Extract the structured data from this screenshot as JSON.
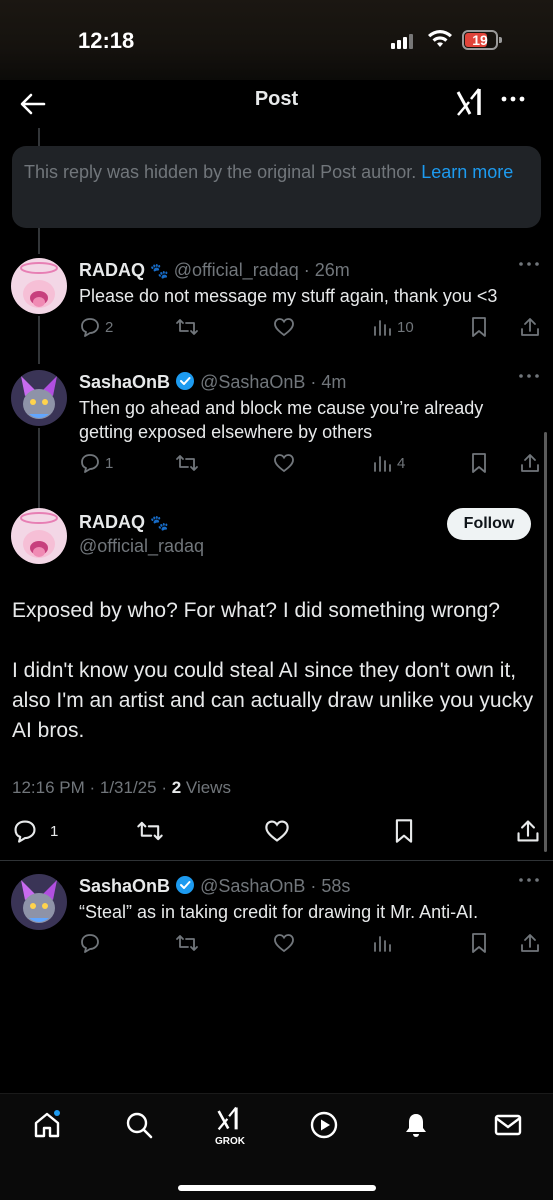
{
  "status_bar": {
    "time": "12:18",
    "battery": "19"
  },
  "nav": {
    "title": "Post"
  },
  "hidden_notice": {
    "text": "This reply was hidden by the original Post author.",
    "link": "Learn more"
  },
  "replies": [
    {
      "name": "RADAQ",
      "handle": "@official_radaq",
      "time": "26m",
      "text": "Please do not message my stuff again, thank you <3",
      "reply_count": "2",
      "views": "10"
    },
    {
      "name": "SashaOnB",
      "handle": "@SashaOnB",
      "time": "4m",
      "text": "Then go ahead and block me cause you’re already getting exposed elsewhere by others",
      "reply_count": "1",
      "views": "4"
    }
  ],
  "main_post": {
    "name": "RADAQ",
    "handle": "@official_radaq",
    "follow_label": "Follow",
    "paragraph1": "Exposed by who? For what? I did something wrong?",
    "paragraph2": "I didn't know you could steal AI since they don't own it, also I'm an artist and can actually draw unlike you yucky AI bros.",
    "timestamp": "12:16 PM · 1/31/25 · ",
    "views_count": "2",
    "views_label": "Views",
    "reply_count": "1"
  },
  "last_reply": {
    "name": "SashaOnB",
    "handle": "@SashaOnB",
    "time": "58s",
    "text": "“Steal” as in taking credit for drawing it Mr. Anti-AI."
  },
  "bottom_nav": {
    "grok_label": "GROK"
  },
  "colors": {
    "accent": "#1d9bf0",
    "background": "#000000",
    "muted": "#71767b",
    "battery": "#e0443a"
  }
}
